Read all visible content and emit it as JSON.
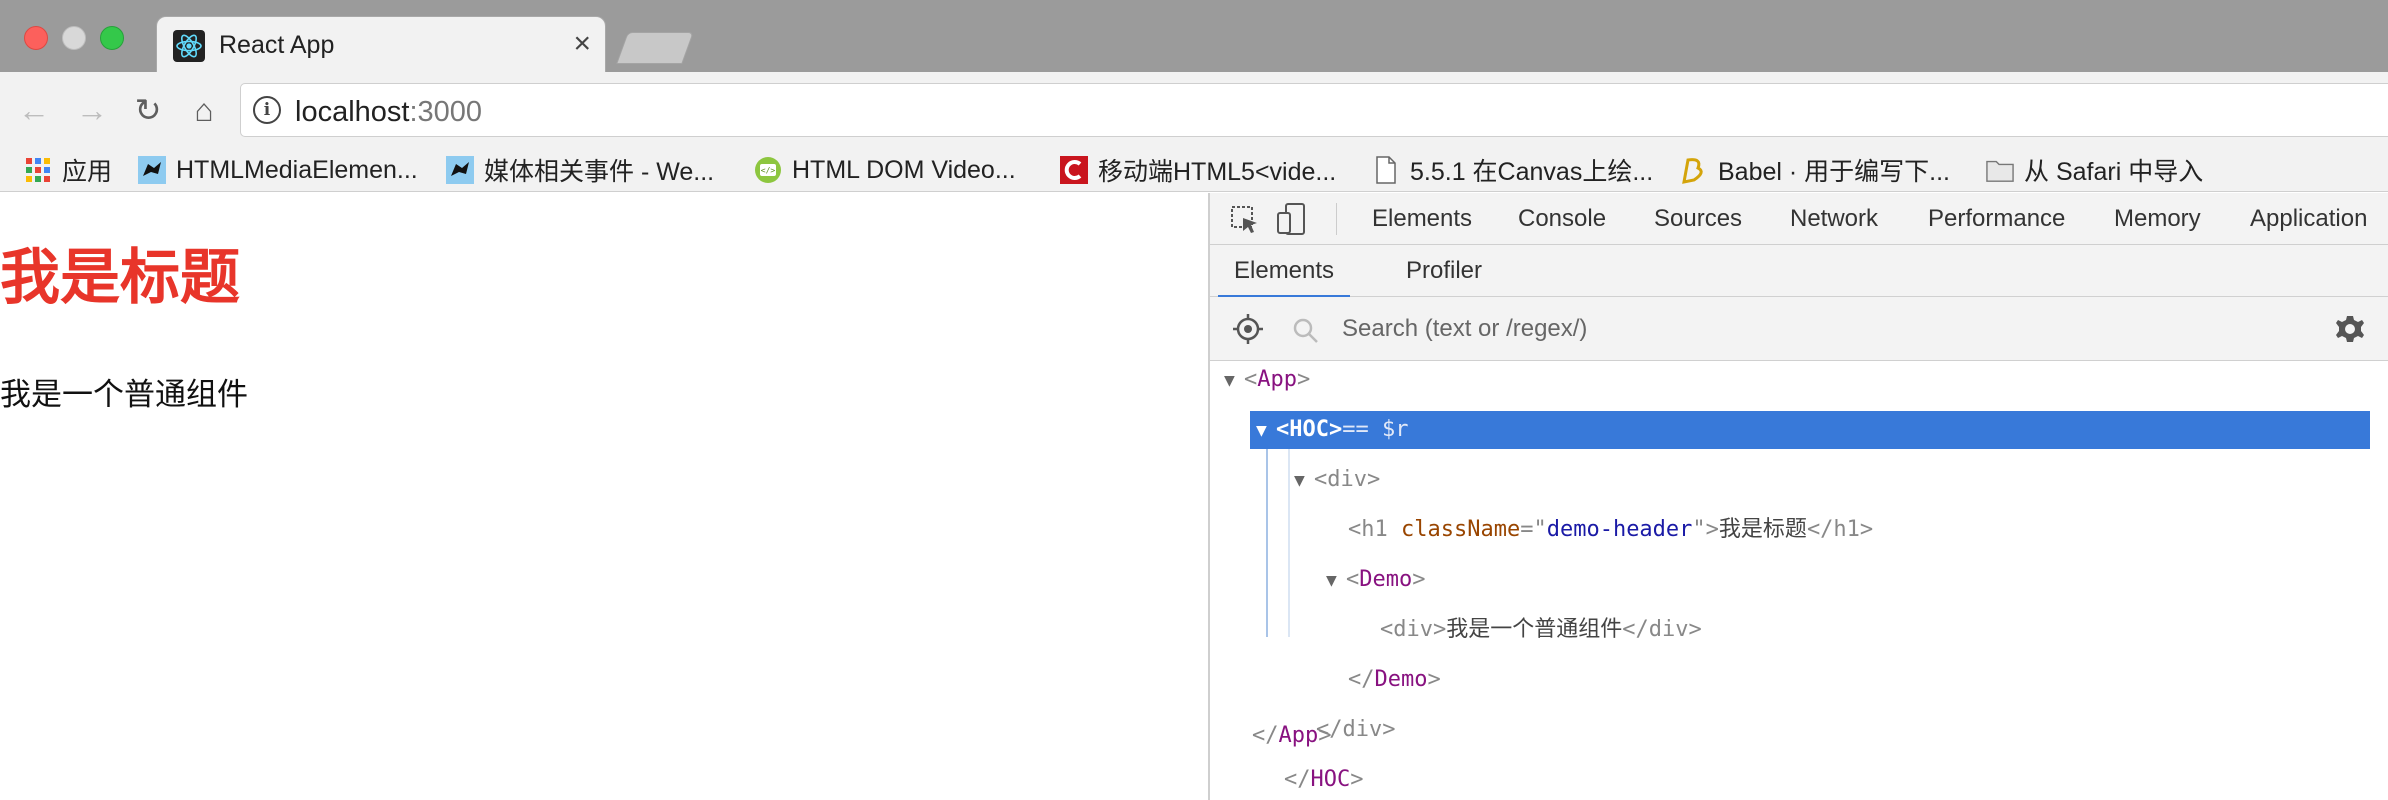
{
  "browser": {
    "tab_title": "React App",
    "tab_close": "×",
    "url_host": "localhost",
    "url_port": ":3000",
    "nav": {
      "back": "←",
      "forward": "→",
      "reload": "↻",
      "home": "⌂"
    },
    "info_glyph": "i"
  },
  "bookmarks": [
    {
      "icon": "apps-grid-icon",
      "label": "应用"
    },
    {
      "icon": "dragon-favicon-icon",
      "label": "HTMLMediaElemen..."
    },
    {
      "icon": "dragon-favicon-icon",
      "label": "媒体相关事件 - We..."
    },
    {
      "icon": "html-favicon-icon",
      "label": "HTML DOM Video..."
    },
    {
      "icon": "csdn-favicon-icon",
      "label": "移动端HTML5<vide..."
    },
    {
      "icon": "document-icon",
      "label": "5.5.1 在Canvas上绘..."
    },
    {
      "icon": "babel-favicon-icon",
      "label": "Babel · 用于编写下..."
    },
    {
      "icon": "folder-icon",
      "label": "从 Safari 中导入"
    }
  ],
  "page": {
    "heading": "我是标题",
    "paragraph": "我是一个普通组件",
    "heading_color": "#e8352a"
  },
  "devtools": {
    "tabs": [
      "Elements",
      "Console",
      "Sources",
      "Network",
      "Performance",
      "Memory",
      "Application"
    ],
    "subtabs": [
      "Elements",
      "Profiler"
    ],
    "search_placeholder": "Search (text or /regex/)",
    "tree": {
      "app_open": "App",
      "hoc_open": "HOC",
      "hoc_suffix": "== $r",
      "div_open": "div",
      "h1_tag": "h1",
      "h1_attr": "className",
      "h1_val": "demo-header",
      "h1_text": "我是标题",
      "demo_open": "Demo",
      "inner_div_text": "我是一个普通组件",
      "div_tag": "div",
      "demo_close": "Demo",
      "div_close": "div",
      "hoc_close": "HOC",
      "app_close": "App"
    },
    "accent": "#3879d9"
  }
}
